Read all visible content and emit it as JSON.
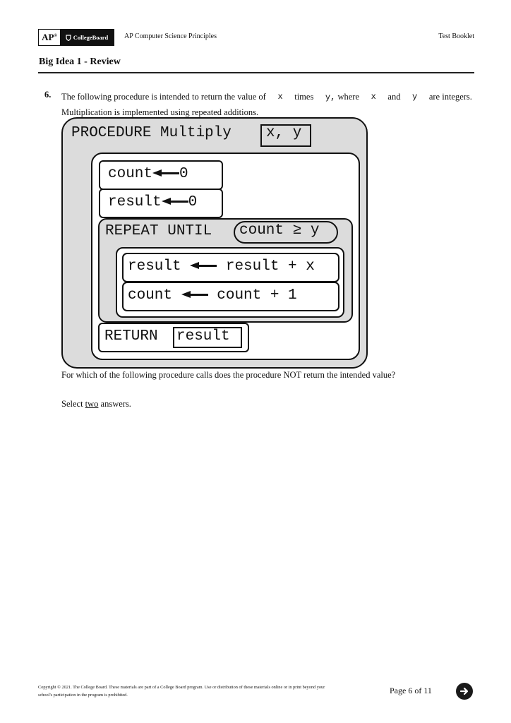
{
  "header": {
    "logo_ap": "AP",
    "logo_cb": "CollegeBoard",
    "course": "AP Computer Science Principles",
    "booklet": "Test Booklet"
  },
  "section_title": "Big Idea 1 - Review",
  "question": {
    "number": "6.",
    "line1_parts": [
      "The following procedure is intended to return the value of",
      "x",
      "times",
      "y,",
      "where",
      "x",
      "and",
      "y",
      "are integers."
    ],
    "line2": "Multiplication is implemented using repeated additions.",
    "prompt": "For which of the following procedure calls does the procedure NOT return the intended value?",
    "select_pre": "Select ",
    "select_emph": "two",
    "select_post": " answers."
  },
  "procedure": {
    "keyword": "PROCEDURE",
    "name": "Multiply",
    "params": "x, y",
    "init1_var": "count",
    "init1_val": "0",
    "init2_var": "result",
    "init2_val": "0",
    "repeat_keyword": "REPEAT UNTIL",
    "condition": "count ≥ y",
    "body1_var": "result",
    "body1_expr": "result + x",
    "body2_var": "count",
    "body2_expr": "count + 1",
    "return_keyword": "RETURN",
    "return_value": "result"
  },
  "footer": {
    "copyright": "Copyright © 2021. The College Board. These materials are part of a College Board program. Use or distribution of these materials online or in print beyond your school's participation in the program is prohibited.",
    "page": "Page 6 of 11",
    "next_icon": "arrow-right-circle-icon"
  }
}
